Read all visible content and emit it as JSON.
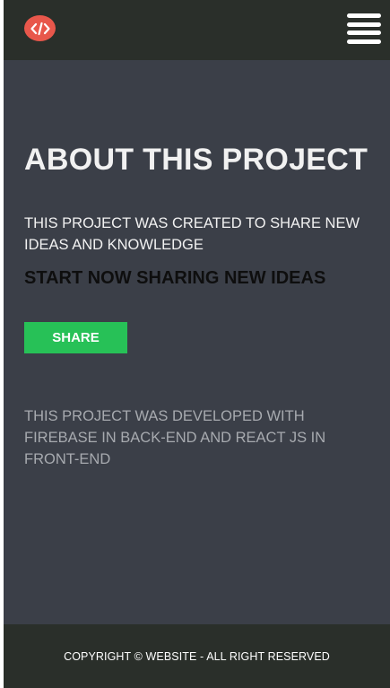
{
  "header": {
    "logo_icon": "code-icon",
    "menu_icon": "hamburger-menu-icon"
  },
  "main": {
    "title": "ABOUT THIS PROJECT",
    "description": "THIS PROJECT WAS CREATED TO SHARE NEW IDEAS AND KNOWLEDGE",
    "subheading": "START NOW SHARING NEW IDEAS",
    "share_label": "SHARE",
    "tech_note": "THIS PROJECT WAS DEVELOPED WITH FIREBASE IN BACK-END AND REACT JS IN FRONT-END"
  },
  "footer": {
    "copyright": "COPYRIGHT © WEBSITE - ALL RIGHT RESERVED"
  },
  "colors": {
    "header_bg": "#2a2f2a",
    "main_bg": "#3b3f48",
    "logo_bg": "#e8574b",
    "share_button_bg": "#27c157",
    "muted_text": "#a7aaaf"
  }
}
